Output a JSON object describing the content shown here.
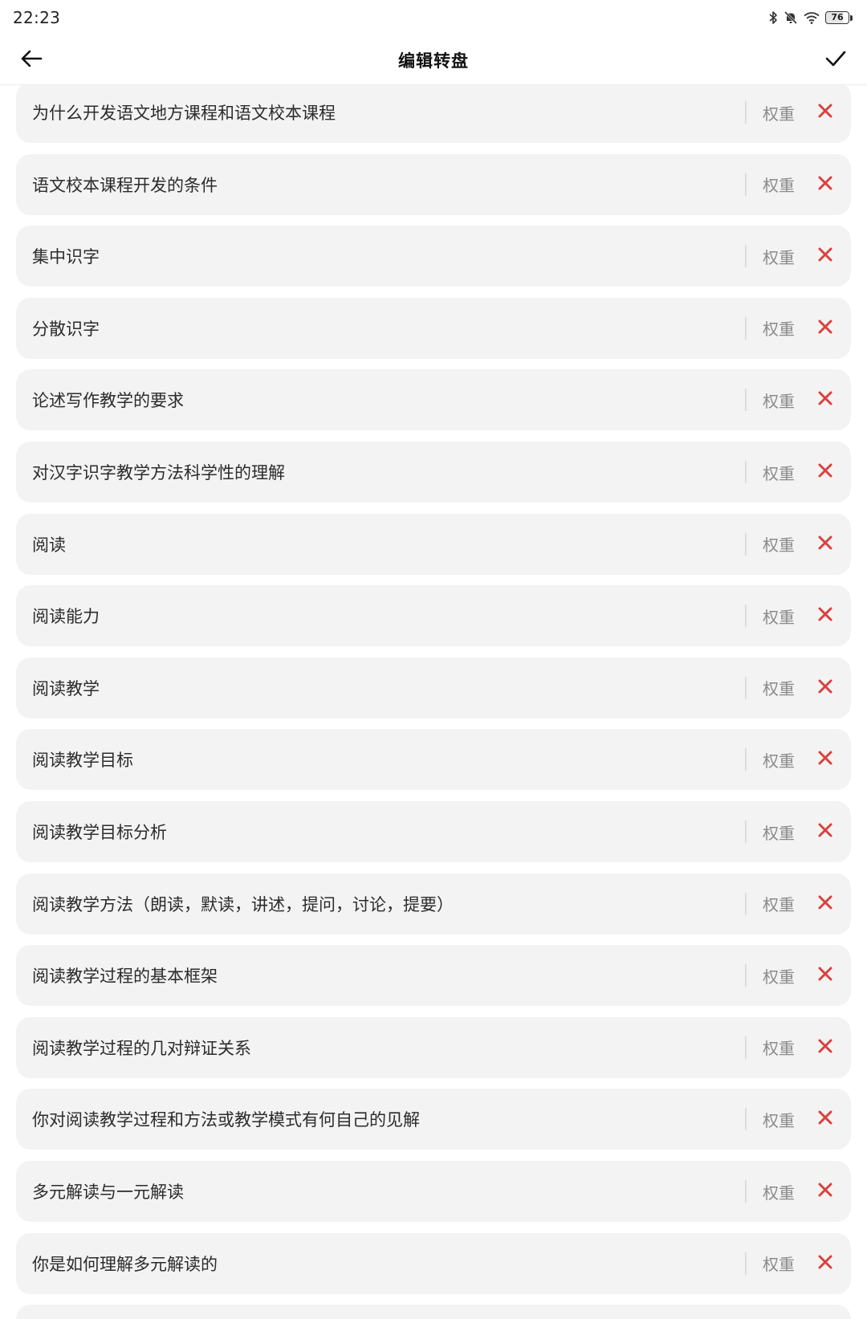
{
  "status_bar": {
    "time": "22:23",
    "battery_level": "76",
    "icons": [
      "bluetooth-icon",
      "mute-bell-icon",
      "wifi-icon",
      "battery-icon"
    ]
  },
  "header": {
    "title": "编辑转盘",
    "back_icon": "back-arrow-icon",
    "confirm_icon": "checkmark-icon"
  },
  "colors": {
    "delete": "#d9413f",
    "item_background": "#f3f3f3",
    "weight_text": "#8a8a8a"
  },
  "items": [
    {
      "label": "为什么开发语文地方课程和语文校本课程",
      "weight_label": "权重"
    },
    {
      "label": "语文校本课程开发的条件",
      "weight_label": "权重"
    },
    {
      "label": "集中识字",
      "weight_label": "权重"
    },
    {
      "label": "分散识字",
      "weight_label": "权重"
    },
    {
      "label": "论述写作教学的要求",
      "weight_label": "权重"
    },
    {
      "label": "对汉字识字教学方法科学性的理解",
      "weight_label": "权重"
    },
    {
      "label": "阅读",
      "weight_label": "权重"
    },
    {
      "label": "阅读能力",
      "weight_label": "权重"
    },
    {
      "label": "阅读教学",
      "weight_label": "权重"
    },
    {
      "label": "阅读教学目标",
      "weight_label": "权重"
    },
    {
      "label": "阅读教学目标分析",
      "weight_label": "权重"
    },
    {
      "label": "阅读教学方法（朗读，默读，讲述，提问，讨论，提要）",
      "weight_label": "权重"
    },
    {
      "label": "阅读教学过程的基本框架",
      "weight_label": "权重"
    },
    {
      "label": "阅读教学过程的几对辩证关系",
      "weight_label": "权重"
    },
    {
      "label": "你对阅读教学过程和方法或教学模式有何自己的见解",
      "weight_label": "权重"
    },
    {
      "label": "多元解读与一元解读",
      "weight_label": "权重"
    },
    {
      "label": "你是如何理解多元解读的",
      "weight_label": "权重"
    }
  ]
}
